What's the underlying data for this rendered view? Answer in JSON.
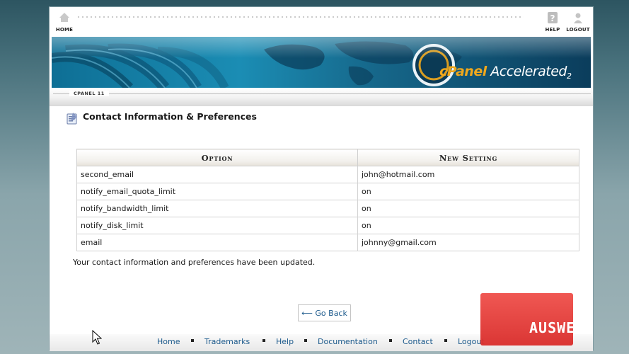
{
  "topbar": {
    "home_label": "HOME",
    "help_label": "HELP",
    "logout_label": "LOGOUT",
    "home_icon": "home-icon",
    "help_icon": "help-icon",
    "logout_icon": "user-icon"
  },
  "banner": {
    "logo_c": "c",
    "logo_panel": "Panel",
    "logo_accelerated": "Accelerated",
    "logo_version": "2"
  },
  "breadcrumb": "CPANEL 11",
  "page": {
    "title": "Contact Information & Preferences",
    "icon": "contact-card-icon"
  },
  "table": {
    "headers": [
      "Option",
      "New Setting"
    ],
    "rows": [
      {
        "option": "second_email",
        "value": "john@hotmail.com"
      },
      {
        "option": "notify_email_quota_limit",
        "value": "on"
      },
      {
        "option": "notify_bandwidth_limit",
        "value": "on"
      },
      {
        "option": "notify_disk_limit",
        "value": "on"
      },
      {
        "option": "email",
        "value": "johnny@gmail.com"
      }
    ]
  },
  "status_message": "Your contact information and preferences have been updated.",
  "go_back_label": "⟵ Go Back",
  "footer": {
    "links": [
      "Home",
      "Trademarks",
      "Help",
      "Documentation",
      "Contact",
      "Logout"
    ]
  },
  "watermark": "AUSWEB",
  "colors": {
    "link": "#1c5a8c",
    "banner": "#1b8db4",
    "accent_orange": "#f0a81c",
    "watermark_red": "#d92c2a"
  }
}
